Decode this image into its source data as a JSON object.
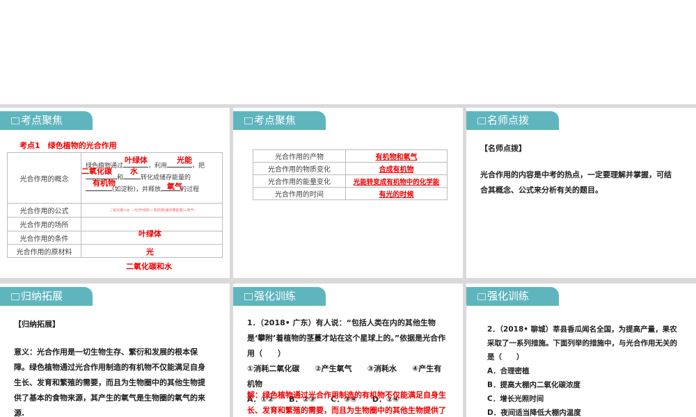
{
  "panels": {
    "p1": {
      "tab": "考点聚焦",
      "heading": "考点1　绿色植物的光合作用",
      "rows": [
        {
          "label": "光合作用的概念"
        },
        {
          "label": "光合作用的公式"
        },
        {
          "label": "光合作用的场所"
        },
        {
          "label": "光合作用的条件"
        },
        {
          "label": "光合作用的原材料"
        }
      ],
      "concept": {
        "t1": "绿色植物通过",
        "t2": "，利用",
        "t3": "，把",
        "t4": "和",
        "t5": "转化成储存能量的",
        "t6": "(如淀粉)，并释放",
        "t7": "的过程",
        "a1": "叶绿体",
        "a2": "光能",
        "a3": "二氧化碳",
        "a4": "水",
        "a5": "有机物",
        "a6": "氧气"
      },
      "formula": "二氧化碳+水 —光/叶绿体→ 有机物(储存着能量)+氧气",
      "place": "叶绿体",
      "condition": "光",
      "material": "二氧化碳和水"
    },
    "p2": {
      "tab": "考点聚焦",
      "rows": [
        {
          "label": "光合作用的产物",
          "answer": "有机物和氧气"
        },
        {
          "label": "光合作用的物质变化",
          "answer": "合成有机物"
        },
        {
          "label": "光合作用的能量变化",
          "answer": "光能转变成有机物中的化学能"
        },
        {
          "label": "光合作用的时间",
          "answer": "有光的时候"
        }
      ]
    },
    "p3": {
      "tab": "名师点拨",
      "title": "【名师点拨】",
      "text": "光合作用的内容是中考的热点，一定要理解并掌握，可结合其概念、公式来分析有关的题目。"
    },
    "p4": {
      "tab": "归纳拓展",
      "title": "【归纳拓展】",
      "text": "意义：光合作用是一切生物生存、繁衍和发展的根本保障。绿色植物通过光合作用制造的有机物不仅能满足自身生长、发育和繁殖的需要，而且为生物圈中的其他生物提供了基本的食物来源，其产生的氧气是生物圈的氧气的来源."
    },
    "p5": {
      "tab": "强化训练",
      "question": "1．（2018• 广东）有人说：“包括人类在内的其他生物是‘攀附’着植物的茎蔓才站在这个星球上的。”依据是光合作用（　　）",
      "choices": "①消耗二氧化碳　　②产生氧气　　③消耗水　　④产生有机物",
      "options": "A．①②　　B．②③　　C．③④　　D．②④",
      "explain": "解：绿色植物通过光合作用制造的有机物不仅能满足自身生长、发育和繁殖的需要，而且为生物圈中的其他生物提供了"
    },
    "p6": {
      "tab": "强化训练",
      "question": "2．（2018• 聊城）莘县香瓜闻名全国，为提高产量，果农采取了一系列措施。下面列举的措施中，与光合作用无关的是（　　）",
      "options": [
        "A．合理密植",
        "B．提高大棚内二氧化碳浓度",
        "C．增长光照时间",
        "D．夜间适当降低大棚内温度"
      ]
    }
  }
}
